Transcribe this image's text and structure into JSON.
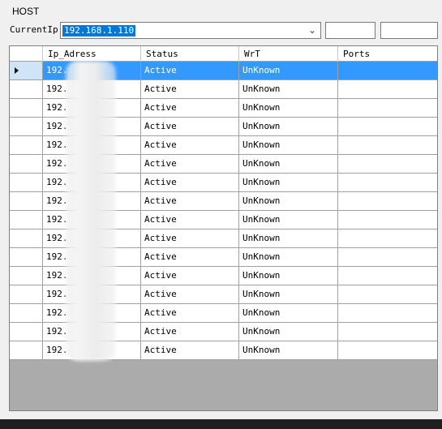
{
  "group": {
    "title": "HOST"
  },
  "current_ip": {
    "label": "CurrentIp",
    "value": "192.168.1.110"
  },
  "extra_fields": [
    {
      "value": ""
    },
    {
      "value": ""
    }
  ],
  "grid": {
    "columns": [
      "Ip_Adress",
      "Status",
      "WrT",
      "Ports"
    ],
    "rows": [
      {
        "ip": "192.",
        "status": "Active",
        "wrt": "UnKnown",
        "ports": ""
      },
      {
        "ip": "192.",
        "status": "Active",
        "wrt": "UnKnown",
        "ports": ""
      },
      {
        "ip": "192.",
        "status": "Active",
        "wrt": "UnKnown",
        "ports": ""
      },
      {
        "ip": "192.",
        "status": "Active",
        "wrt": "UnKnown",
        "ports": ""
      },
      {
        "ip": "192.",
        "status": "Active",
        "wrt": "UnKnown",
        "ports": ""
      },
      {
        "ip": "192.",
        "status": "Active",
        "wrt": "UnKnown",
        "ports": ""
      },
      {
        "ip": "192.",
        "status": "Active",
        "wrt": "UnKnown",
        "ports": ""
      },
      {
        "ip": "192.",
        "status": "Active",
        "wrt": "UnKnown",
        "ports": ""
      },
      {
        "ip": "192.",
        "status": "Active",
        "wrt": "UnKnown",
        "ports": ""
      },
      {
        "ip": "192.",
        "status": "Active",
        "wrt": "UnKnown",
        "ports": ""
      },
      {
        "ip": "192.",
        "status": "Active",
        "wrt": "UnKnown",
        "ports": ""
      },
      {
        "ip": "192.",
        "status": "Active",
        "wrt": "UnKnown",
        "ports": ""
      },
      {
        "ip": "192.",
        "status": "Active",
        "wrt": "UnKnown",
        "ports": ""
      },
      {
        "ip": "192.",
        "status": "Active",
        "wrt": "UnKnown",
        "ports": ""
      },
      {
        "ip": "192.",
        "status": "Active",
        "wrt": "UnKnown",
        "ports": ""
      },
      {
        "ip": "192.",
        "status": "Active",
        "wrt": "UnKnown",
        "ports": ""
      }
    ],
    "selected_row": 0
  },
  "icons": {
    "dropdown": "chevron-down-icon",
    "row_indicator": "current-row-triangle-icon"
  },
  "colors": {
    "selection": "#3399ff",
    "grid_background": "#ababab",
    "combo_highlight": "#0078d7"
  }
}
